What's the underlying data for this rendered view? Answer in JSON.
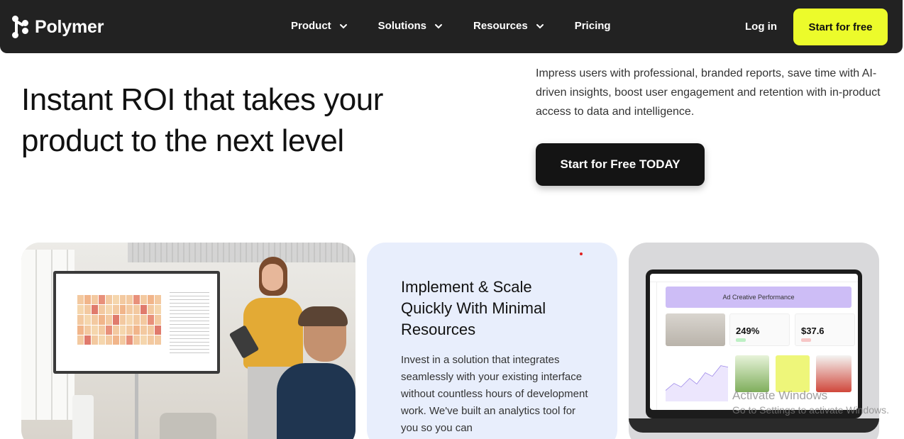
{
  "nav": {
    "brand": "Polymer",
    "items": [
      {
        "label": "Product",
        "has_dropdown": true
      },
      {
        "label": "Solutions",
        "has_dropdown": true
      },
      {
        "label": "Resources",
        "has_dropdown": true
      },
      {
        "label": "Pricing",
        "has_dropdown": false
      }
    ],
    "login": "Log in",
    "cta": "Start for free",
    "cta_color": "#ecfb2b",
    "bg_color": "#222222"
  },
  "hero": {
    "title_line1": "Instant ROI that takes your",
    "title_line2": "product to the next level",
    "description": "Impress users with professional, branded reports, save time with AI-driven insights, boost user engagement and retention with in-product access to data and intelligence.",
    "cta": "Start for Free TODAY"
  },
  "cards": {
    "feature": {
      "title": "Implement & Scale Quickly With Minimal Resources",
      "body": "Invest in a solution that integrates seamlessly with your existing interface without countless hours of development work. We've built an analytics tool for you so you can"
    },
    "laptop": {
      "header": "Ad Creative Performance",
      "kpi1": "249%",
      "kpi2": "$37.6"
    }
  },
  "watermark": {
    "line1": "Activate Windows",
    "line2": "Go to Settings to activate Windows."
  }
}
